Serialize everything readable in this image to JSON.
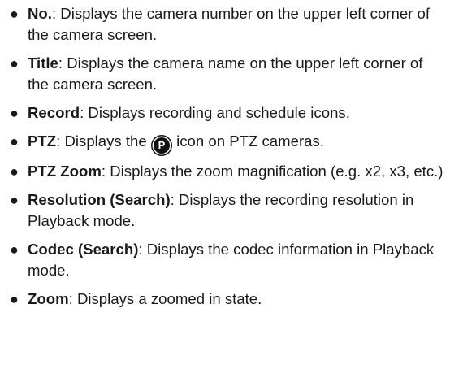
{
  "items": [
    {
      "term": "No.",
      "sep": ":",
      "desc": " Displays the camera number on the upper left corner of the camera screen."
    },
    {
      "term": "Title",
      "sep": ":",
      "desc": " Displays the camera name on the upper left corner of the camera screen."
    },
    {
      "term": "Record",
      "sep": ":",
      "desc": " Displays recording and schedule icons."
    },
    {
      "term": "PTZ",
      "sep": ":",
      "desc_before": " Displays the ",
      "icon": "ptz-p-icon",
      "icon_glyph": "P",
      "desc_after": " icon on PTZ cameras."
    },
    {
      "term": "PTZ Zoom",
      "sep": ":",
      "desc": " Displays the zoom magnification (e.g. x2, x3, etc.)"
    },
    {
      "term": "Resolution (Search)",
      "sep": ":",
      "desc": " Displays the recording resolution in Playback mode."
    },
    {
      "term": "Codec (Search)",
      "sep": ":",
      "desc": " Displays the codec information in Playback mode."
    },
    {
      "term": "Zoom",
      "sep": ":",
      "desc": " Displays a zoomed in state."
    }
  ]
}
